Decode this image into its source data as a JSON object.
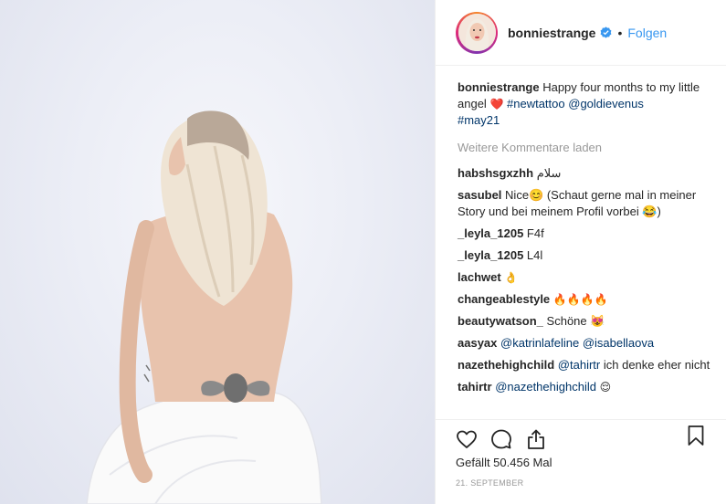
{
  "post": {
    "username": "bonniestrange",
    "follow_label": "Folgen",
    "separator": "•",
    "caption_user": "bonniestrange",
    "caption_text": "Happy four months to my little angel",
    "caption_emoji": "❤️",
    "caption_hashtag1": "#newtattoo",
    "caption_mention": "@goldievenus",
    "caption_hashtag2": "#may21",
    "load_more": "Weitere Kommentare laden",
    "likes": "Gefällt 50.456 Mal",
    "date": "21. SEPTEMBER"
  },
  "comments": [
    {
      "user": "habshsgxzhh",
      "text": "سلام"
    },
    {
      "user": "sasubel",
      "text": "Nice😊 (Schaut gerne mal in meiner Story und bei meinem Profil vorbei 😂)"
    },
    {
      "user": "_leyla_1205",
      "text": "F4f"
    },
    {
      "user": "_leyla_1205",
      "text": "L4l"
    },
    {
      "user": "lachwet",
      "text": "👌"
    },
    {
      "user": "changeablestyle",
      "text": "🔥🔥🔥🔥"
    },
    {
      "user": "beautywatson_",
      "text": "Schöne 😻"
    },
    {
      "user": "aasyax",
      "mention1": "@katrinlafeline",
      "mention2": "@isabellaova"
    },
    {
      "user": "nazethehighchild",
      "mention1": "@tahirtr",
      "text": "ich denke eher nicht"
    },
    {
      "user": "tahirtr",
      "mention1": "@nazethehighchild",
      "text": "😌"
    }
  ],
  "icons": {
    "like": "heart-icon",
    "comment": "comment-bubble-icon",
    "share": "share-icon",
    "save": "bookmark-icon",
    "verified": "verified-badge-icon"
  },
  "colors": {
    "link": "#003569",
    "follow": "#3897f0",
    "muted": "#999999",
    "verified": "#3897f0"
  }
}
